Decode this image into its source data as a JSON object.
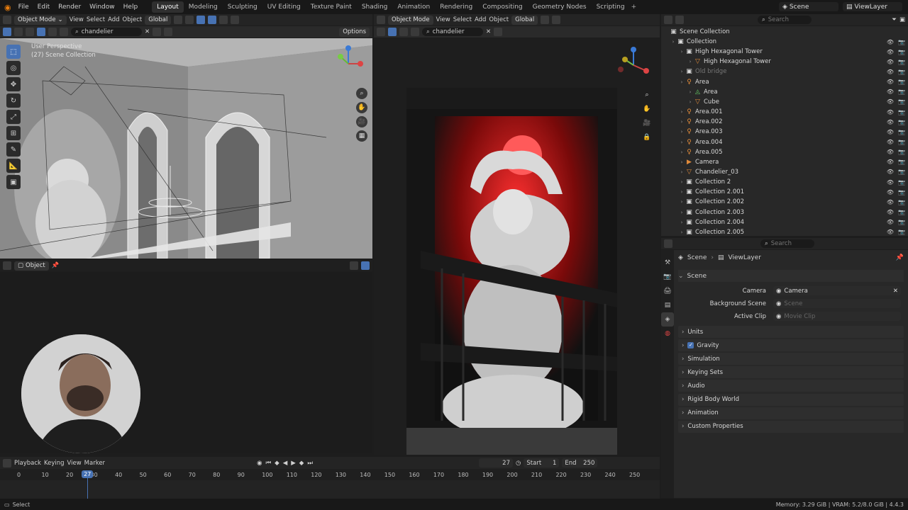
{
  "menu": [
    "File",
    "Edit",
    "Render",
    "Window",
    "Help"
  ],
  "workspaces": [
    "Layout",
    "Modeling",
    "Sculpting",
    "UV Editing",
    "Texture Paint",
    "Shading",
    "Animation",
    "Rendering",
    "Compositing",
    "Geometry Nodes",
    "Scripting"
  ],
  "top_right": {
    "scene": "Scene",
    "view_layer": "ViewLayer"
  },
  "left_view": {
    "mode": "Object Mode",
    "menus": [
      "View",
      "Select",
      "Add",
      "Object"
    ],
    "orientation": "Global",
    "search": "chandelier",
    "options": "Options",
    "overlay_title": "User Perspective",
    "overlay_sub": "(27) Scene Collection"
  },
  "right_view": {
    "mode": "Object Mode",
    "menus": [
      "View",
      "Select",
      "Add",
      "Object"
    ],
    "orientation": "Global",
    "search": "chandelier"
  },
  "lower_left": {
    "mode": "Object"
  },
  "outliner": {
    "search_placeholder": "Search",
    "root": "Scene Collection",
    "items": [
      {
        "label": "Collection",
        "indent": 1,
        "icon": "collection"
      },
      {
        "label": "High Hexagonal Tower",
        "indent": 2,
        "icon": "collection"
      },
      {
        "label": "High Hexagonal Tower",
        "indent": 3,
        "icon": "mesh"
      },
      {
        "label": "Old bridge",
        "indent": 2,
        "icon": "collection",
        "dim": true
      },
      {
        "label": "Area",
        "indent": 2,
        "icon": "light"
      },
      {
        "label": "Area",
        "indent": 3,
        "icon": "light-data"
      },
      {
        "label": "Cube",
        "indent": 3,
        "icon": "mesh"
      },
      {
        "label": "Area.001",
        "indent": 2,
        "icon": "light"
      },
      {
        "label": "Area.002",
        "indent": 2,
        "icon": "light"
      },
      {
        "label": "Area.003",
        "indent": 2,
        "icon": "light"
      },
      {
        "label": "Area.004",
        "indent": 2,
        "icon": "light"
      },
      {
        "label": "Area.005",
        "indent": 2,
        "icon": "light"
      },
      {
        "label": "Camera",
        "indent": 2,
        "icon": "camera"
      },
      {
        "label": "Chandelier_03",
        "indent": 2,
        "icon": "mesh"
      },
      {
        "label": "Collection 2",
        "indent": 2,
        "icon": "collection"
      },
      {
        "label": "Collection 2.001",
        "indent": 2,
        "icon": "collection"
      },
      {
        "label": "Collection 2.002",
        "indent": 2,
        "icon": "collection"
      },
      {
        "label": "Collection 2.003",
        "indent": 2,
        "icon": "collection"
      },
      {
        "label": "Collection 2.004",
        "indent": 2,
        "icon": "collection"
      },
      {
        "label": "Collection 2.005",
        "indent": 2,
        "icon": "collection"
      }
    ]
  },
  "properties": {
    "search_placeholder": "Search",
    "breadcrumb": [
      "Scene",
      "ViewLayer"
    ],
    "section": "Scene",
    "fields": [
      {
        "label": "Camera",
        "value": "Camera",
        "placeholder": false
      },
      {
        "label": "Background Scene",
        "value": "Scene",
        "placeholder": true
      },
      {
        "label": "Active Clip",
        "value": "Movie Clip",
        "placeholder": true
      }
    ],
    "panels": [
      "Units",
      "Gravity",
      "Simulation",
      "Keying Sets",
      "Audio",
      "Rigid Body World",
      "Animation",
      "Custom Properties"
    ]
  },
  "timeline": {
    "menus": [
      "Playback",
      "Keying",
      "View",
      "Marker"
    ],
    "current_frame": "27",
    "start_label": "Start",
    "start": "1",
    "end_label": "End",
    "end": "250",
    "ticks": [
      "0",
      "10",
      "20",
      "30",
      "40",
      "50",
      "60",
      "70",
      "80",
      "90",
      "100",
      "110",
      "120",
      "130",
      "140",
      "150",
      "160",
      "170",
      "180",
      "190",
      "200",
      "210",
      "220",
      "230",
      "240",
      "250"
    ],
    "playhead_label": "27"
  },
  "status": {
    "left": "Select",
    "right": "Memory: 3.29 GiB | VRAM: 5.2/8.0 GiB | 4.4.3"
  }
}
